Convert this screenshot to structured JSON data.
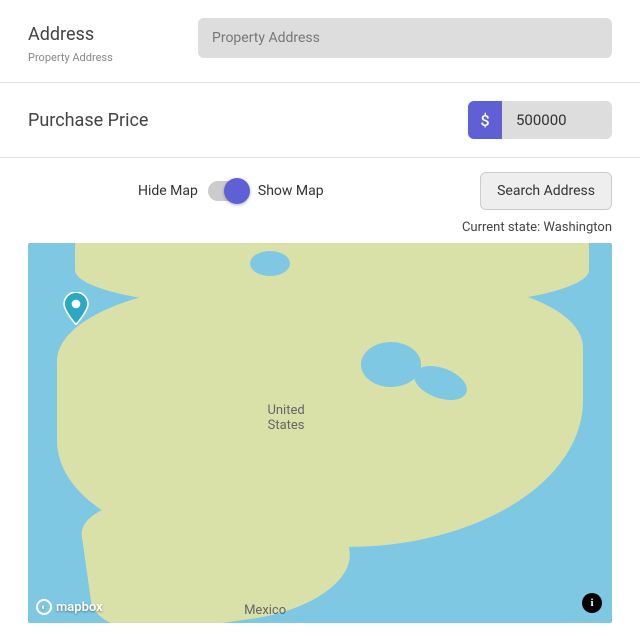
{
  "address": {
    "label": "Address",
    "sublabel": "Property Address",
    "placeholder": "Property Address",
    "value": ""
  },
  "price": {
    "label": "Purchase Price",
    "currency_symbol": "$",
    "value": "500000"
  },
  "map_toggle": {
    "off_label": "Hide Map",
    "on_label": "Show Map",
    "state": true
  },
  "search_button": "Search Address",
  "current_state": {
    "prefix": "Current state: ",
    "value": "Washington"
  },
  "map": {
    "country_label_us": "United\nStates",
    "country_label_mx": "Mexico",
    "attribution": "mapbox"
  }
}
